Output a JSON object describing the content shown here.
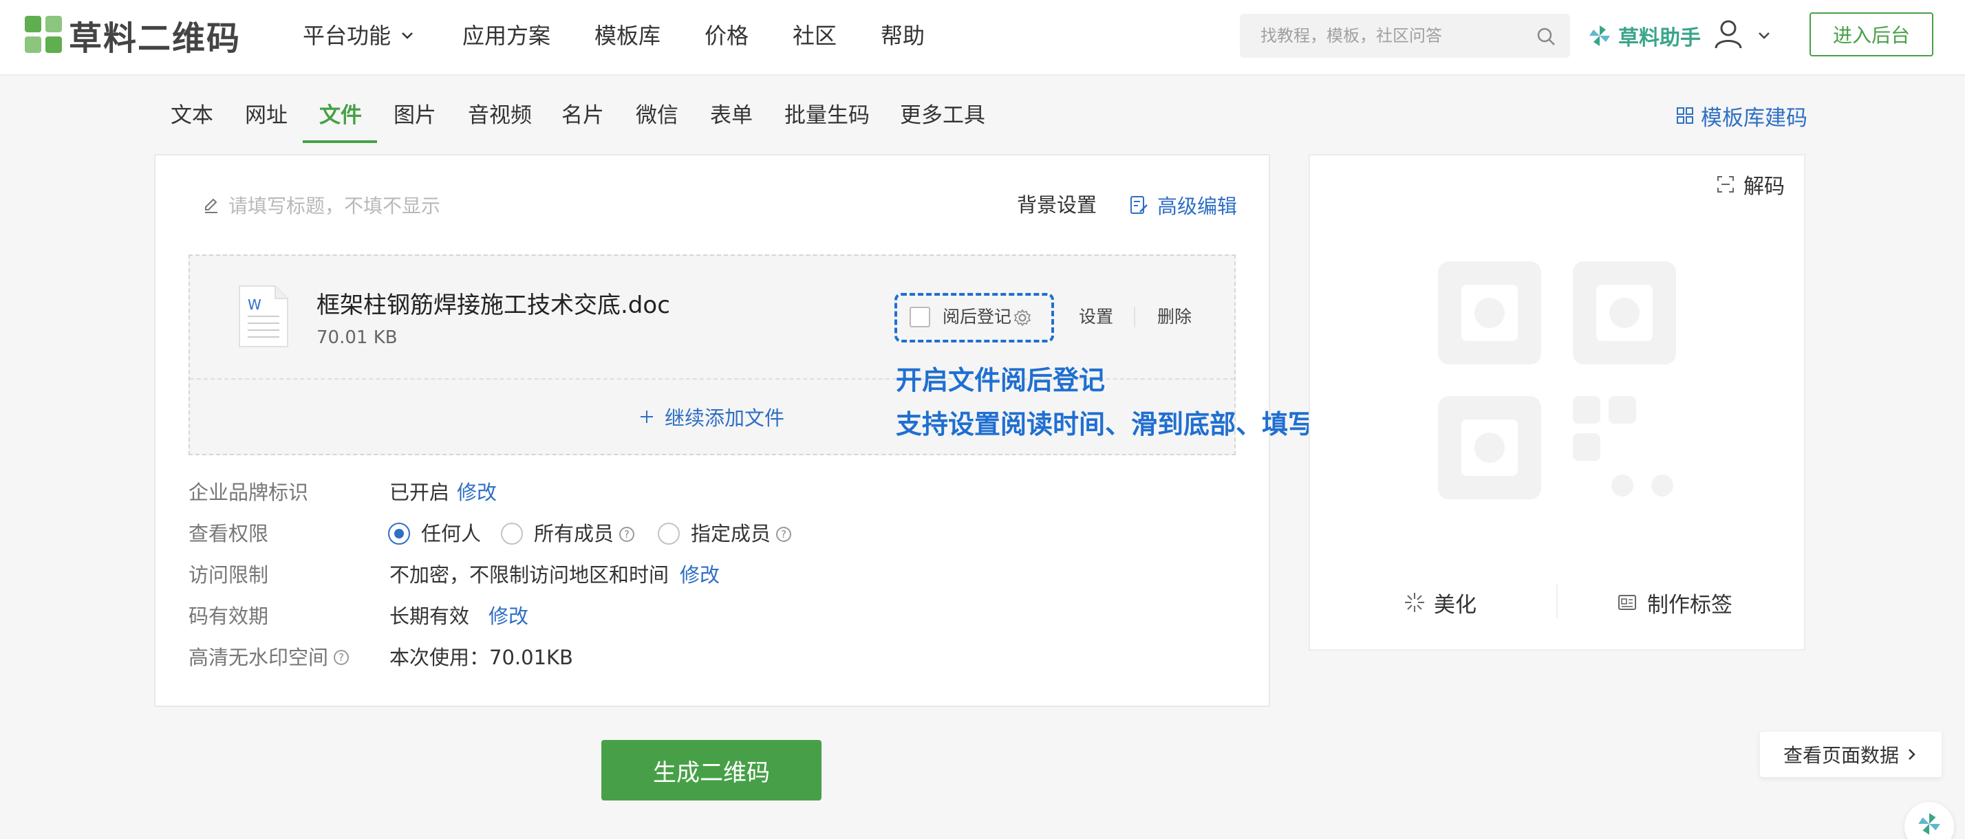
{
  "header": {
    "logo_text": "草料二维码",
    "nav": [
      {
        "label": "平台功能"
      },
      {
        "label": "应用方案"
      },
      {
        "label": "模板库"
      },
      {
        "label": "价格"
      },
      {
        "label": "社区"
      },
      {
        "label": "帮助"
      }
    ],
    "search_placeholder": "找教程，模板，社区问答",
    "helper_label": "草料助手",
    "admin_button": "进入后台"
  },
  "tabs": [
    {
      "label": "文本"
    },
    {
      "label": "网址"
    },
    {
      "label": "文件",
      "active": true
    },
    {
      "label": "图片"
    },
    {
      "label": "音视频"
    },
    {
      "label": "名片"
    },
    {
      "label": "微信"
    },
    {
      "label": "表单"
    },
    {
      "label": "批量生码"
    },
    {
      "label": "更多工具"
    }
  ],
  "template_link": "模板库建码",
  "editor": {
    "title_placeholder": "请填写标题，不填不显示",
    "bg_setting": "背景设置",
    "advanced_edit": "高级编辑"
  },
  "file": {
    "icon_letter": "W",
    "name": "框架柱钢筋焊接施工技术交底.doc",
    "size": "70.01 KB",
    "register_label": "阅后登记",
    "register_checked": false,
    "setting": "设置",
    "delete": "删除",
    "add_more": "继续添加文件"
  },
  "callout": {
    "line1": "开启文件阅后登记",
    "line2": "支持设置阅读时间、滑到底部、填写表单等要求"
  },
  "settings": {
    "brand": {
      "label": "企业品牌标识",
      "value": "已开启",
      "action": "修改"
    },
    "permission": {
      "label": "查看权限",
      "options": [
        {
          "label": "任何人",
          "selected": true
        },
        {
          "label": "所有成员",
          "selected": false
        },
        {
          "label": "指定成员",
          "selected": false
        }
      ]
    },
    "access": {
      "label": "访问限制",
      "value": "不加密，不限制访问地区和时间",
      "action": "修改"
    },
    "validity": {
      "label": "码有效期",
      "value": "长期有效",
      "action": "修改"
    },
    "storage": {
      "label": "高清无水印空间",
      "value": "本次使用：70.01KB"
    }
  },
  "generate_button": "生成二维码",
  "qr_panel": {
    "decode": "解码",
    "beautify": "美化",
    "make_label": "制作标签"
  },
  "page_data_button": "查看页面数据",
  "colors": {
    "brand_green": "#47a047",
    "link_blue": "#2f6fc4",
    "callout_blue": "#1f6fd1"
  }
}
